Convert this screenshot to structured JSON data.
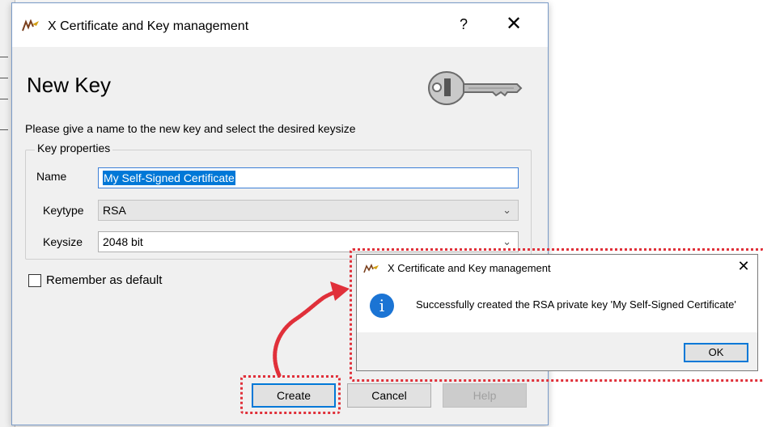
{
  "main_dialog": {
    "title": "X Certificate and Key management",
    "help_glyph": "?",
    "close_glyph": "✕",
    "heading": "New Key",
    "instruction": "Please give a name to the new key and select the desired keysize",
    "group_title": "Key properties",
    "name_label": "Name",
    "name_value": "My Self-Signed Certificate",
    "keytype_label": "Keytype",
    "keytype_value": "RSA",
    "keysize_label": "Keysize",
    "keysize_value": "2048 bit",
    "remember_label": "Remember as default",
    "remember_checked": false,
    "buttons": {
      "create": "Create",
      "cancel": "Cancel",
      "help": "Help"
    },
    "icons": {
      "app": "xca-logo-icon",
      "key": "key-icon",
      "dropdown": "chevron-down-icon"
    }
  },
  "message_box": {
    "title": "X Certificate and Key management",
    "close_glyph": "✕",
    "info_glyph": "i",
    "text": "Successfully created the RSA private key 'My Self-Signed Certificate'",
    "ok_label": "OK"
  },
  "colors": {
    "accent": "#0078d7",
    "annotation": "#e0303a",
    "info": "#1b74d4"
  }
}
